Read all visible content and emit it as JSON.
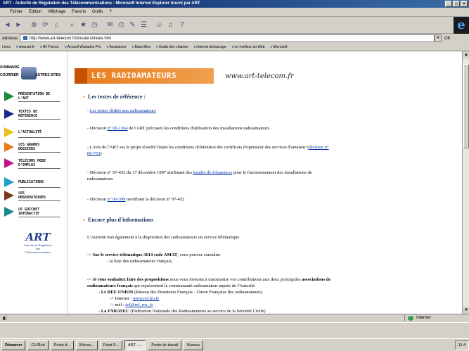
{
  "window": {
    "title": "ART - Autorité de Régulation des Télécommunications - Microsoft Internet Explorer fourni par ART"
  },
  "menu": [
    "Fichier",
    "Edition",
    "Affichage",
    "Favoris",
    "Outils",
    "?"
  ],
  "address": {
    "label": "Adresse",
    "url": "http://www.art-telecom.fr/dossiers/index.htm",
    "go_label": "OK"
  },
  "links": {
    "label": "Liens",
    "items": [
      "www.art.fr",
      "AV France",
      "Accueil Wanadoo Pro",
      "Assistance",
      "Baux Bleu",
      "Guide des chaines",
      "Internet demarrage",
      "Le meilleur du Web",
      "Microsoft"
    ]
  },
  "sidebar": {
    "summary": "SOMMAIRE",
    "courrier": "COURRIER",
    "autres_sites": "AUTRES SITES",
    "items": [
      {
        "label": "PRÉSENTATION DE L'ART",
        "color": "#1a8a3a"
      },
      {
        "label": "TEXTES DE RÉFÉRENCE",
        "color": "#1a2a8a"
      },
      {
        "label": "L'ACTUALITÉ",
        "color": "#e8c21a"
      },
      {
        "label": "LES GRANDS DOSSIERS",
        "color": "#e87a1a"
      },
      {
        "label": "TÉLÉCOMS MODE D'EMPLOI",
        "color": "#c2148a"
      },
      {
        "label": "PUBLICATIONS",
        "color": "#1aa0c8"
      },
      {
        "label": "LES OBSERVATOIRES",
        "color": "#7a3a1a"
      },
      {
        "label": "LE GUICHET INTERACTIF",
        "color": "#1a8a8a"
      }
    ],
    "logo_text": "ART",
    "logo_sub": "Autorité de Régulation des Télécommunications"
  },
  "banner": {
    "title": "LES RADIOAMATEURS",
    "site": "www.art-telecom.fr"
  },
  "section1": {
    "heading": "Les textes de référence :",
    "l1_prefix": "- ",
    "l1_link": "Les textes dédiés aux radioamateurs",
    "l2_prefix": "- Décision ",
    "l2_link": "n° 00-1364",
    "l2_suffix": " de l'ART précisant les conditions d'utilisation des installations radioamateurs",
    "l3_a": "- L'avis de l'ART sur le projet d'arrêté fixant les conditions d'obtention des certificats d'opérateur des services d'amateur (",
    "l3_link1": "décision n°",
    "l3_link2": "00-753",
    "l3_b": ")",
    "l4_a": "- Décision n° 97-452 du 17 décembre 1997 attribuant des ",
    "l4_link": "bandes de fréquences",
    "l4_b": " pour le fonctionnement des installations de",
    "l4_c": "radioamateurs",
    "l5_prefix": "- Décision ",
    "l5_link": "n° 00-399",
    "l5_suffix": " modifiant la décision n° 97-452"
  },
  "section2": {
    "heading": "Encore plus d'informations",
    "intro": "L'Autorité met également à la disposition des radioamateurs un service télématique",
    "s1_arrow": "-> ",
    "s1_bold": "Sur le service télématique 3614 code AMAT",
    "s1_rest": ", vous pouvez consulter",
    "s1_sub": "- la liste des radioamateurs français,",
    "s2_arrow": "-> ",
    "s2_bold": "Si vous souhaitez faire des propositions",
    "s2_rest": " nous vous invitons à transmettre vos contributions aux deux principales ",
    "s2_bold2": "associations de",
    "s2_line2_bold": "radioamateurs français",
    "s2_line2_rest": " qui représentent la communauté radioamateur auprès de l'Autorité.",
    "ref_bold": "Le REF-UNION",
    "ref_rest": " (Réseau des Emetteurs Français - Union Française des radioamateurs)",
    "ref_internet_label": "-> Internet : ",
    "ref_internet_link": "www.ref.fm.fr",
    "ref_mail_label": "-> mél : ",
    "ref_mail_link": "ref@ref_nw_fr",
    "fnra_bold": "La FNRASEC",
    "fnra_rest": " (Fédération Nationale des Radioamateurs au service de la Sécurité Civile)"
  },
  "status": {
    "zone": "Internet"
  },
  "taskbar": {
    "start": "Démarrer",
    "tasks": [
      "CV/Red",
      "Poste d...",
      "Micros...",
      "Paint S...",
      "ART - ...",
      "Poste de travail",
      "Bureau"
    ],
    "clock": "11:4"
  }
}
